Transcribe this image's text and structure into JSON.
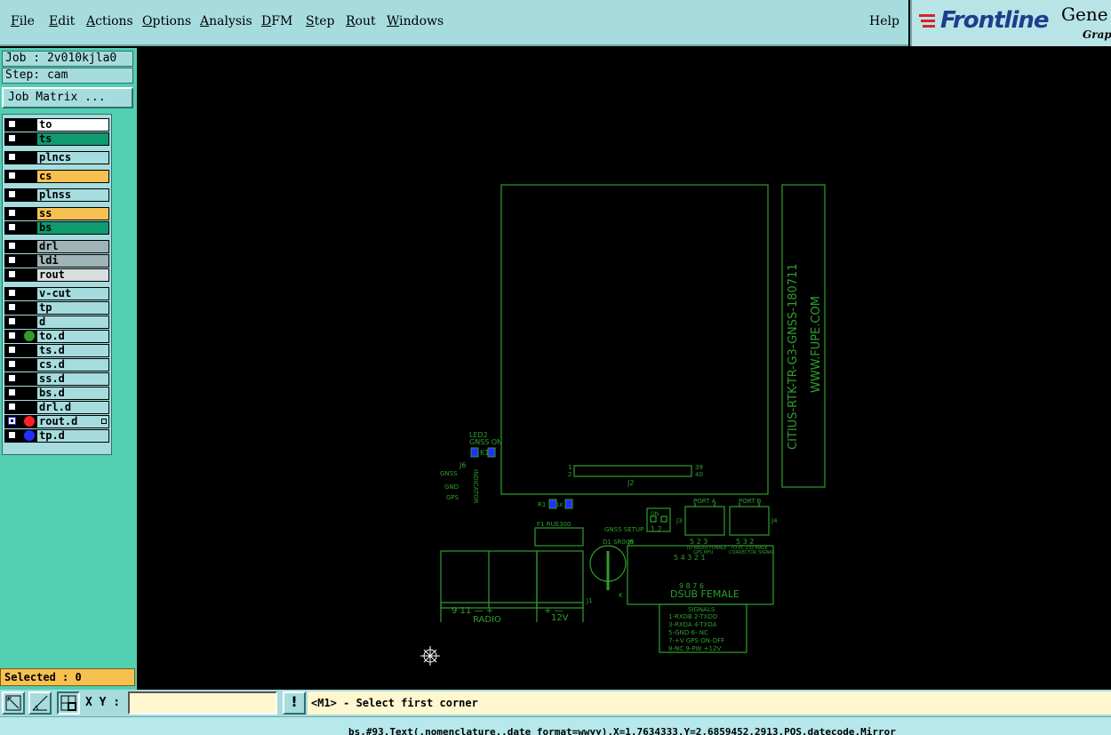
{
  "menu": {
    "items": [
      {
        "label": "File",
        "underline": "F",
        "rest": "ile"
      },
      {
        "label": "Edit",
        "underline": "E",
        "rest": "dit"
      },
      {
        "label": "Actions",
        "underline": "A",
        "rest": "ctions"
      },
      {
        "label": "Options",
        "underline": "O",
        "rest": "ptions"
      },
      {
        "label": "Analysis",
        "underline": "A",
        "rest": "nalysis"
      },
      {
        "label": "DFM",
        "underline": "D",
        "rest": "FM"
      },
      {
        "label": "Step",
        "underline": "S",
        "rest": "tep"
      },
      {
        "label": "Rout",
        "underline": "R",
        "rest": "out"
      },
      {
        "label": "Windows",
        "underline": "W",
        "rest": "indows"
      }
    ],
    "help": "Help"
  },
  "logo": {
    "brand": "Frontline",
    "product": "Gene",
    "product_sub": "Grap"
  },
  "job": {
    "job_text": "Job : 2v010kjla0",
    "step_text": "Step: cam",
    "matrix_button": "Job Matrix ..."
  },
  "layers": [
    {
      "name": "to",
      "color": "#ffffff",
      "dot": null,
      "group": 0
    },
    {
      "name": "ts",
      "color": "#0f9a70",
      "dot": null,
      "group": 0
    },
    {
      "name": "plncs",
      "color": "#a6dcde",
      "dot": null,
      "group": 1
    },
    {
      "name": "cs",
      "color": "#f7c152",
      "dot": null,
      "group": 2
    },
    {
      "name": "plnss",
      "color": "#a6dcde",
      "dot": null,
      "group": 3
    },
    {
      "name": "ss",
      "color": "#f7c152",
      "dot": null,
      "group": 4
    },
    {
      "name": "bs",
      "color": "#0f9a70",
      "dot": null,
      "group": 4
    },
    {
      "name": "drl",
      "color": "#a0b4b8",
      "dot": null,
      "group": 5
    },
    {
      "name": "ldi",
      "color": "#a0b4b8",
      "dot": null,
      "group": 5
    },
    {
      "name": "rout",
      "color": "#d8dede",
      "dot": null,
      "group": 5
    },
    {
      "name": "v-cut",
      "color": "#a6dcde",
      "dot": null,
      "group": 6
    },
    {
      "name": "tp",
      "color": "#a6dcde",
      "dot": null,
      "group": 6
    },
    {
      "name": "d",
      "color": "#a6dcde",
      "dot": null,
      "group": 6
    },
    {
      "name": "to.d",
      "color": "#a6dcde",
      "dot": "#2e9e2e",
      "group": 6
    },
    {
      "name": "ts.d",
      "color": "#a6dcde",
      "dot": null,
      "group": 6
    },
    {
      "name": "cs.d",
      "color": "#a6dcde",
      "dot": null,
      "group": 6
    },
    {
      "name": "ss.d",
      "color": "#a6dcde",
      "dot": null,
      "group": 6
    },
    {
      "name": "bs.d",
      "color": "#a6dcde",
      "dot": null,
      "group": 6
    },
    {
      "name": "drl.d",
      "color": "#a6dcde",
      "dot": null,
      "group": 6
    },
    {
      "name": "rout.d",
      "color": "#a6dcde",
      "dot": "#ff2020",
      "group": 6,
      "affected": true
    },
    {
      "name": "tp.d",
      "color": "#a6dcde",
      "dot": "#2030ff",
      "group": 6
    }
  ],
  "selected": "Selected : 0",
  "toolbar": {
    "xy_label": "X Y :",
    "xy_value": "",
    "prompt": "<M1> - Select first corner",
    "bang": "!"
  },
  "status": "bs.#93.Text(.nomenclature..date format=wwyy).X=1.7634333.Y=2.6859452.2913.POS.datecode.Mirror",
  "board": {
    "side_text_1": "CITIUS-RTK-TR-G3-GNSS-180711",
    "side_text_2": "WWW.FUPE.COM",
    "labels": {
      "led2": "LED2",
      "gnss_on": "GNSS ON",
      "j6": "J6",
      "gnss": "GNSS",
      "gnd": "GND",
      "gps": "GPS",
      "indicator": "INDICATOR",
      "j2": "J2",
      "pin1": "1",
      "pin2": "2",
      "pin39": "39",
      "pin40": "40",
      "r1": "R1",
      "r1k": "1K",
      "f1": "F1 RUE300",
      "gnss_setup": "GNSS SETUP",
      "on": "ON",
      "on12": "1  2",
      "j3": "J3",
      "port_a": "PORT A",
      "port_b": "PORT B",
      "j4": "J4",
      "j5": "J5",
      "d1": "D1 SR008",
      "k": "K",
      "j1": "J1",
      "radio": "RADIO",
      "v12": "12V",
      "dsub": "DSUB FEMALE",
      "radio_pins": "9   11   —    +",
      "v12_pins": "+   —",
      "porta_pins": "5  2  3",
      "porta_sub": "TO RADIO FEMALE",
      "porta_sub2": "GPS MFU",
      "portb_pins": "5  3  2",
      "portb_sub": "TO PC 232 MALE",
      "portb_sub2": "CORRECTOR SIGNAL",
      "dsub_top": "5   4  3  2  1",
      "dsub_bot": "9   8   7   6",
      "signals": "SIGNALS",
      "sig1": "1-RXDB    2-TXDD",
      "sig2": "3-RXDA    4-TXDA",
      "sig3": "5-GND     6- NC",
      "sig4": "7-+V GPS  ON-OFF",
      "sig5": "8-NC      9-PW +12V"
    }
  }
}
